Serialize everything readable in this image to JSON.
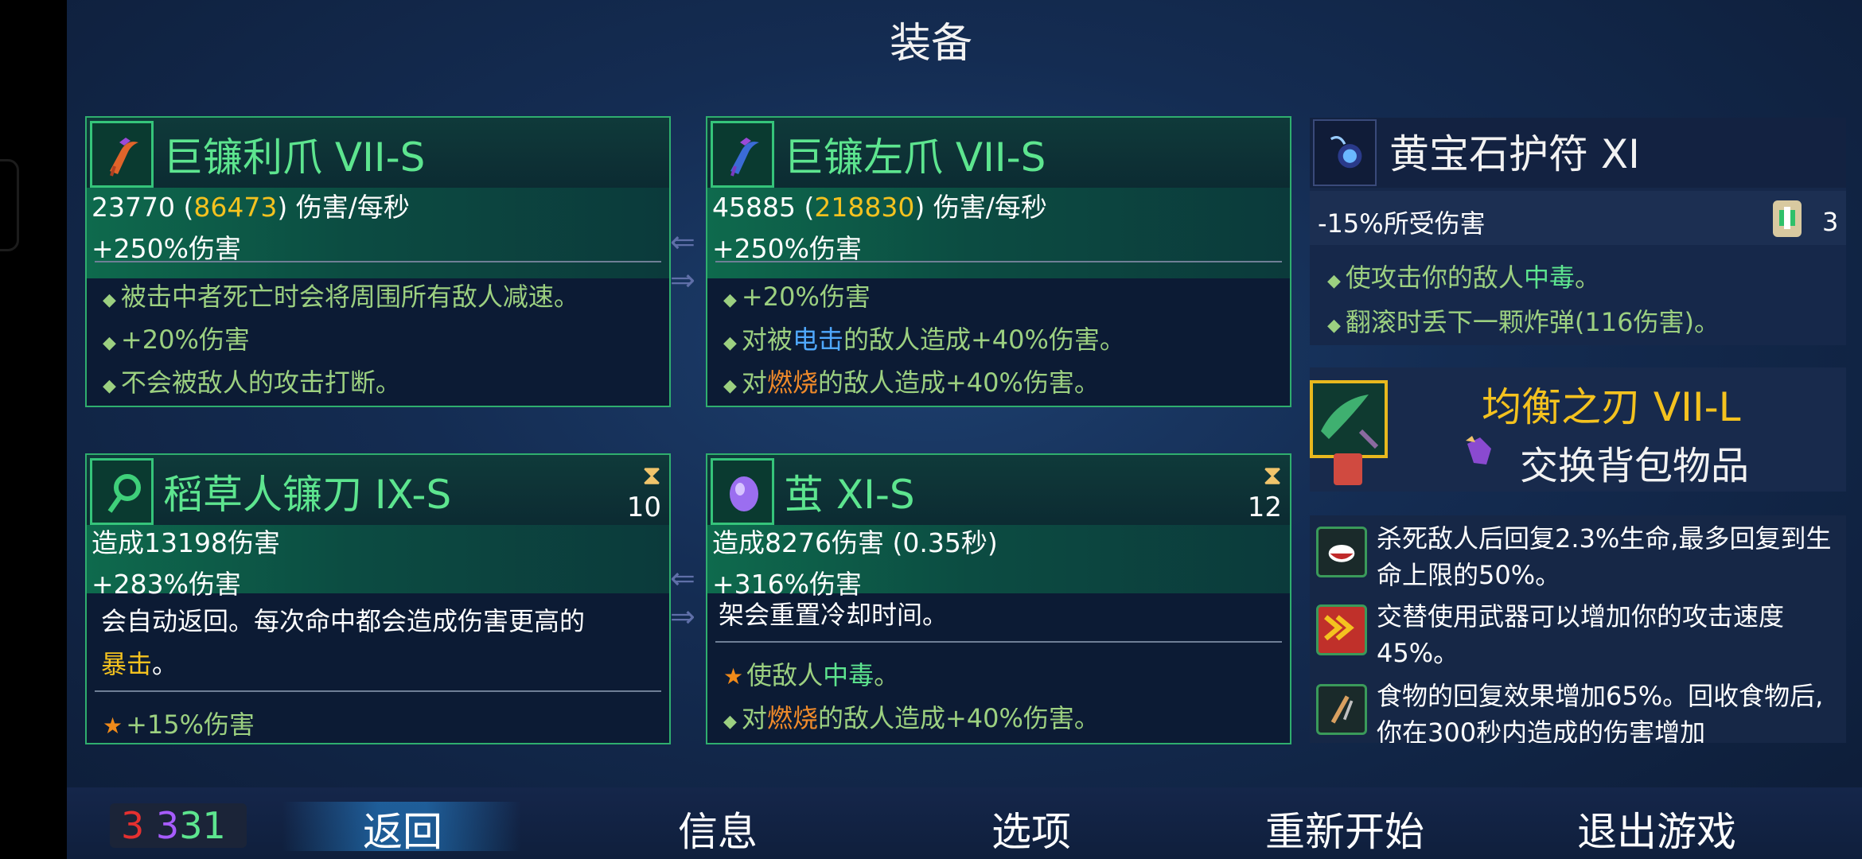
{
  "header": {
    "title": "装备"
  },
  "weapons": [
    {
      "name": "巨镰利爪 VII-S",
      "dps_base": "23770",
      "dps_crit": "86473",
      "dps_suffix": "伤害/每秒",
      "bonus": "+250%伤害",
      "affixes": [
        "被击中者死亡时会将周围所有敌人减速。",
        "+20%伤害",
        "不会被敌人的攻击打断。"
      ]
    },
    {
      "name": "巨镰左爪 VII-S",
      "dps_base": "45885",
      "dps_crit": "218830",
      "dps_suffix": "伤害/每秒",
      "bonus": "+250%伤害",
      "affix1": "+20%伤害",
      "affix2_a": "对被",
      "affix2_kw": "电击",
      "affix2_b": "的敌人造成+40%伤害。",
      "affix3_a": "对",
      "affix3_kw": "燃烧",
      "affix3_b": "的敌人造成+40%伤害。"
    }
  ],
  "skills": [
    {
      "name": "稻草人镰刀 IX-S",
      "cooldown": "10",
      "damage": "造成13198伤害",
      "bonus": "+283%伤害",
      "desc_line1": "会自动返回。每次命中都会造成伤害更高的",
      "desc_kw": "暴击",
      "desc_end": "。",
      "affix": "+15%伤害"
    },
    {
      "name": "茧 XI-S",
      "cooldown": "12",
      "damage": "造成8276伤害 (0.35秒)",
      "bonus": "+316%伤害",
      "desc_line1": "架会重置冷却时间。",
      "affix1_a": "使敌人",
      "affix1_kw": "中毒",
      "affix1_b": "。",
      "affix2_a": "对",
      "affix2_kw": "燃烧",
      "affix2_b": "的敌人造成+40%伤害。"
    }
  ],
  "amulet": {
    "name": "黄宝石护符 XI",
    "stat": "-15%所受伤害",
    "scroll_count": "3",
    "affix1_a": "使攻击你的敌人",
    "affix1_kw": "中毒",
    "affix1_b": "。",
    "affix2": "翻滚时丢下一颗炸弹(116伤害)。"
  },
  "backpack": {
    "name": "均衡之刃 VII-L",
    "action": "交换背包物品"
  },
  "mutations": [
    {
      "icon": "vampirism-mutation-icon",
      "text": "杀死敌人后回复2.3%生命,最多回复到生命上限的50%。"
    },
    {
      "icon": "combo-mutation-icon",
      "text": "交替使用武器可以增加你的攻击速度45%。"
    },
    {
      "icon": "food-mutation-icon",
      "text": "食物的回复效果增加65%。回收食物后,你在300秒内造成的伤害增加"
    }
  ],
  "scrolls": {
    "brutality": "3",
    "tactics": "3",
    "survival": "31"
  },
  "menu": {
    "back": "返回",
    "info": "信息",
    "options": "选项",
    "restart": "重新开始",
    "quit": "退出游戏"
  },
  "colors": {
    "accent_green": "#5de58f",
    "gold": "#f4c21f",
    "brutality": "#e53030",
    "tactics": "#a75cff",
    "survival": "#5de58f"
  }
}
